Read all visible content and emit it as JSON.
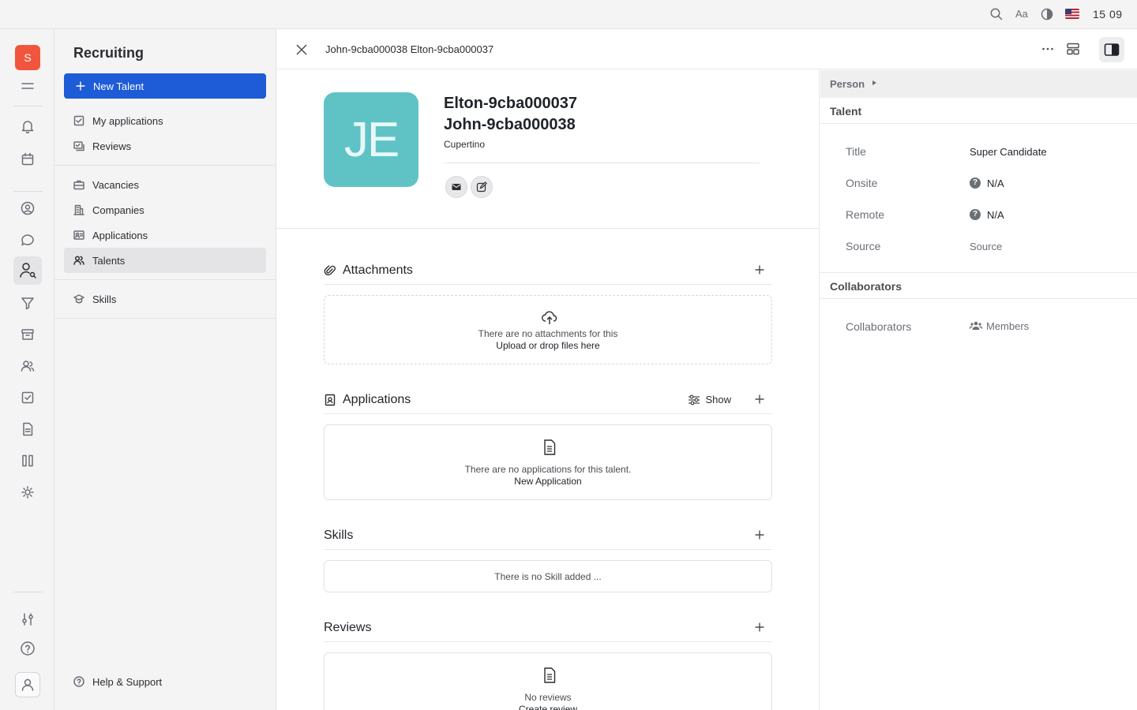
{
  "topbar": {
    "font_label": "Aa",
    "time": "15 09",
    "icons": [
      "search-icon",
      "font-icon",
      "contrast-icon",
      "us-flag-icon"
    ]
  },
  "rail": {
    "workspace_letter": "S",
    "icons": [
      "menu-icon",
      "bell-icon",
      "calendar-icon",
      "contacts-icon",
      "chat-icon",
      "recruiting-icon",
      "funnel-icon",
      "archive-icon",
      "people-icon",
      "checkbox-icon",
      "document-icon",
      "board-icon",
      "sun-icon",
      "settings-icon",
      "help-icon",
      "profile-icon"
    ]
  },
  "nav": {
    "title": "Recruiting",
    "new_button": "New Talent",
    "items": [
      {
        "label": "My applications",
        "icon": "checkbox-icon"
      },
      {
        "label": "Reviews",
        "icon": "reviews-icon"
      },
      {
        "label": "Vacancies",
        "icon": "briefcase-icon"
      },
      {
        "label": "Companies",
        "icon": "building-icon"
      },
      {
        "label": "Applications",
        "icon": "id-card-icon"
      },
      {
        "label": "Talents",
        "icon": "people-icon",
        "selected": true
      },
      {
        "label": "Skills",
        "icon": "graduation-icon"
      }
    ],
    "help": "Help & Support"
  },
  "header": {
    "title": "John-9cba000038 Elton-9cba000037"
  },
  "profile": {
    "initials": "JE",
    "avatar_color": "#5fc3c6",
    "last_name": "Elton-9cba000037",
    "first_name": "John-9cba000038",
    "city": "Cupertino"
  },
  "sections": {
    "attachments": {
      "title": "Attachments",
      "empty": "There are no attachments for this",
      "action": "Upload or drop files here"
    },
    "applications": {
      "title": "Applications",
      "show": "Show",
      "empty": "There are no applications for this talent.",
      "action": "New Application"
    },
    "skills": {
      "title": "Skills",
      "empty": "There is no Skill added ..."
    },
    "reviews": {
      "title": "Reviews",
      "empty": "No reviews",
      "action": "Create review"
    }
  },
  "aside": {
    "person_label": "Person",
    "talent_label": "Talent",
    "fields": [
      {
        "label": "Title",
        "value": "Super Candidate"
      },
      {
        "label": "Onsite",
        "value": "N/A"
      },
      {
        "label": "Remote",
        "value": "N/A"
      },
      {
        "label": "Source",
        "value": "Source"
      }
    ],
    "collaborators_group": "Collaborators",
    "collaborators_label": "Collaborators",
    "collaborators_value": "Members",
    "unknown_glyph": "?"
  },
  "colors": {
    "accent": "#1e5bd6",
    "workspace": "#f2553d",
    "avatar": "#5fc3c6"
  }
}
